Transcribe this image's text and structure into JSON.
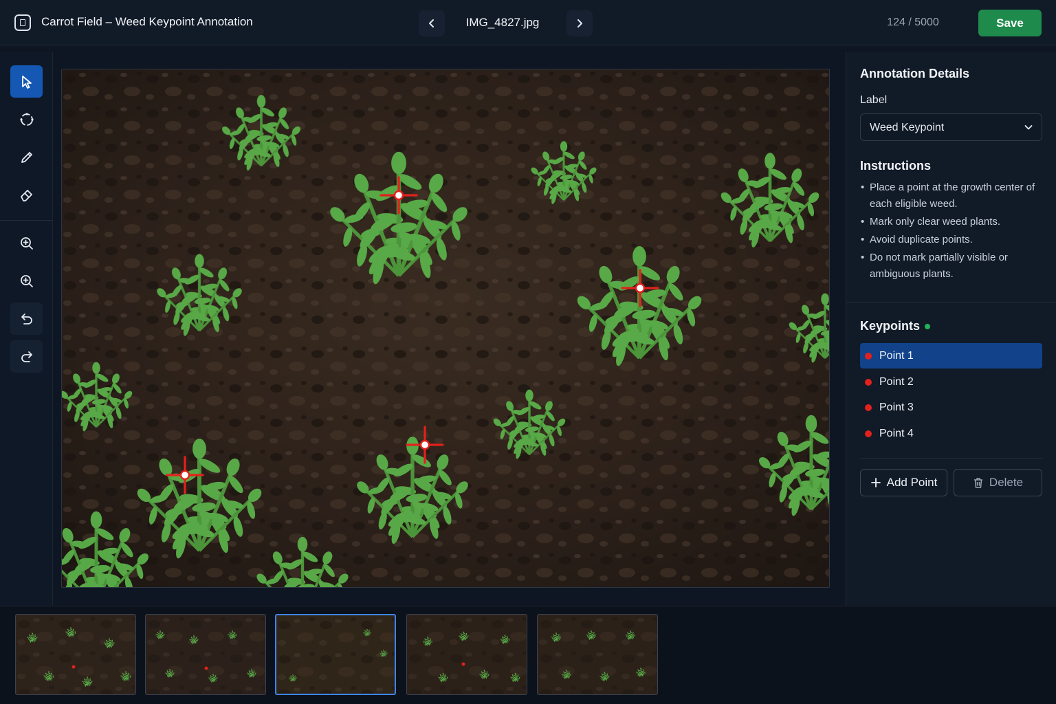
{
  "header": {
    "title": "Carrot Field – Weed Keypoint Annotation",
    "filename": "IMG_4827.jpg",
    "counter": "124 / 5000",
    "save_label": "Save"
  },
  "toolbar": {
    "tools": [
      "select-tool",
      "lasso-tool",
      "pencil-tool",
      "eraser-tool",
      "zoom-in-tool",
      "zoom-tool",
      "undo-tool",
      "redo-tool"
    ],
    "active_tool": "select-tool"
  },
  "panel": {
    "title": "Annotation Details",
    "label_caption": "Label",
    "label_value": "Weed Keypoint",
    "instructions_title": "Instructions",
    "instructions": [
      "Place a point at the growth center of each eligible weed.",
      "Mark only clear weed plants.",
      "Avoid duplicate points.",
      "Do not mark partially visible or ambiguous plants."
    ],
    "keypoints_title": "Keypoints",
    "keypoints": [
      {
        "label": "Point 1",
        "selected": true
      },
      {
        "label": "Point 2",
        "selected": false
      },
      {
        "label": "Point 3",
        "selected": false
      },
      {
        "label": "Point 4",
        "selected": false
      }
    ],
    "add_label": "Add Point",
    "delete_label": "Delete"
  },
  "filmstrip": {
    "count": 5,
    "active_index": 2
  },
  "colors": {
    "accent": "#1458b4",
    "save": "#1e8a4c",
    "keypoint": "#e3211c",
    "status_dot": "#21b25a"
  }
}
